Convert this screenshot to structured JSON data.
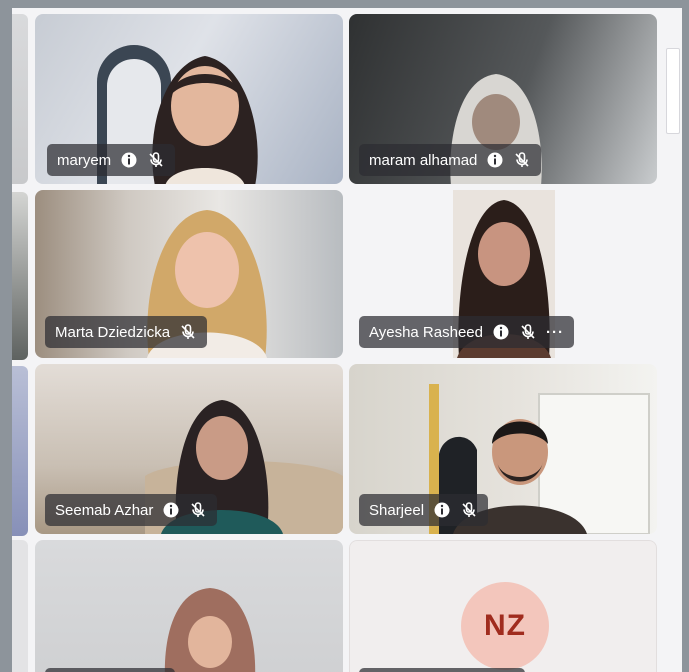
{
  "participants": [
    {
      "name": "maryem",
      "has_info_icon": true,
      "muted": true
    },
    {
      "name": "maram alhamad",
      "has_info_icon": true,
      "muted": true
    },
    {
      "name": "Marta Dziedzicka",
      "has_info_icon": false,
      "muted": true
    },
    {
      "name": "Ayesha Rasheed",
      "has_info_icon": true,
      "muted": true,
      "more": "···"
    },
    {
      "name": "Seemab Azhar",
      "has_info_icon": true,
      "muted": true
    },
    {
      "name": "Sharjeel",
      "has_info_icon": true,
      "muted": true
    },
    {
      "name": "",
      "has_info_icon": false,
      "muted": true
    },
    {
      "name": "",
      "has_info_icon": false,
      "muted": true,
      "initials": "NZ"
    }
  ],
  "colors": {
    "avatar_bg": "#f3c6bc",
    "avatar_text": "#a02c1e",
    "label_bg": "rgba(44,44,50,0.72)"
  },
  "icons": [
    "info-icon",
    "mic-off-icon",
    "more-options-icon"
  ]
}
